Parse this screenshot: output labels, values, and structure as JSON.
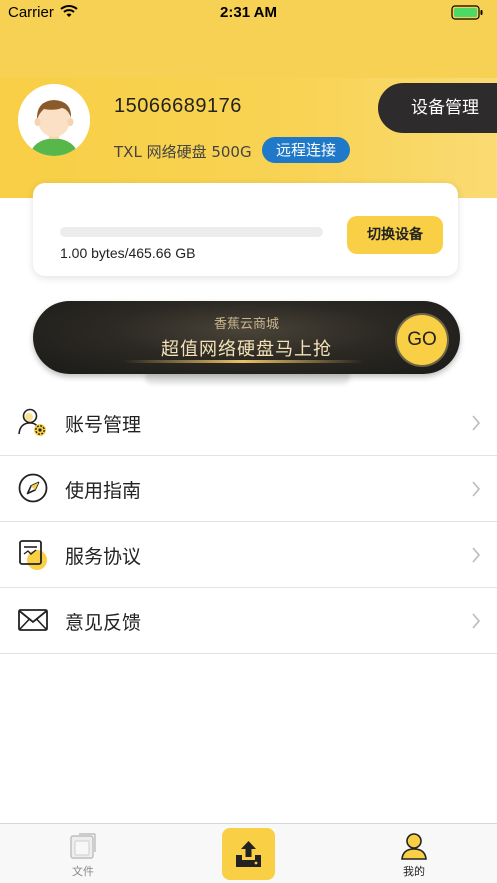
{
  "status_bar": {
    "carrier": "Carrier",
    "time": "2:31 AM"
  },
  "profile": {
    "phone": "15066689176",
    "device_name": "TXL 网络硬盘 500G",
    "remote_badge": "远程连接",
    "manage_button": "设备管理"
  },
  "storage": {
    "usage_text": "1.00 bytes/465.66 GB",
    "used_fraction": 0.0,
    "switch_button": "切换设备"
  },
  "promo": {
    "subtitle": "香蕉云商城",
    "title": "超值网络硬盘马上抢",
    "go_label": "GO"
  },
  "menu": {
    "items": [
      {
        "label": "账号管理",
        "icon": "account-settings-icon"
      },
      {
        "label": "使用指南",
        "icon": "compass-icon"
      },
      {
        "label": "服务协议",
        "icon": "document-icon"
      },
      {
        "label": "意见反馈",
        "icon": "mail-icon"
      }
    ]
  },
  "tab_bar": {
    "files_label": "文件",
    "mine_label": "我的"
  },
  "colors": {
    "accent": "#f8cf45",
    "badge_blue": "#1f78c8",
    "dark": "#2d2b2b"
  }
}
